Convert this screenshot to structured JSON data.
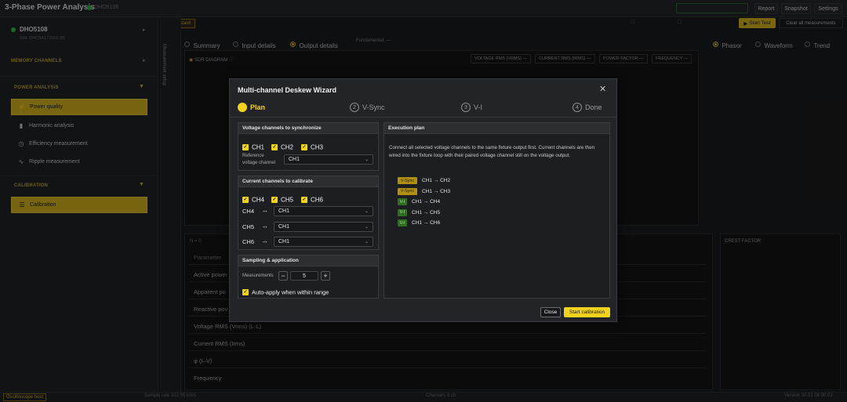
{
  "app": {
    "title": "3-Phase Power Analysis",
    "device_tag": "DHO5108",
    "live_status": "",
    "topbar_buttons": [
      "Report",
      "Snapshot",
      "Settings"
    ],
    "start_test_label": "Start Test",
    "clear_label": "Clear all measurements",
    "wizard_label": "Wizard",
    "wide_toggle_1": "",
    "wide_toggle_2": ""
  },
  "sidebar": {
    "device_name": "DHO5108",
    "device_serial": "S/N: DHO5A172000 (B)",
    "memory_channels": "MEMORY CHANNELS",
    "power_analysis": "POWER ANALYSIS",
    "items": [
      {
        "label": "Power quality",
        "icon": "power-quality-icon",
        "glyph": "⚡"
      },
      {
        "label": "Harmonic analysis",
        "icon": "harmonic-icon",
        "glyph": "▮"
      },
      {
        "label": "Efficiency measurement",
        "icon": "efficiency-icon",
        "glyph": "◷"
      },
      {
        "label": "Ripple measurement",
        "icon": "ripple-icon",
        "glyph": "∿"
      }
    ],
    "calibration": "CALIBRATION",
    "calibration_item": {
      "label": "Calibration",
      "icon": "sliders-icon",
      "glyph": "☰"
    }
  },
  "vertical_tab": "Measurement setup",
  "main": {
    "tabs": [
      "Summary",
      "Input details",
      "Output details"
    ],
    "fundamental": "Fundamental: —",
    "views": [
      "Phasor",
      "Waveform",
      "Trend"
    ],
    "sdr_diagram": "SDR DIAGRAM",
    "chips": [
      "VOLTAGE RMS (VRMS) —",
      "CURRENT RMS (IRMS) —",
      "POWER FACTOR —",
      "FREQUENCY —"
    ],
    "n_label": "N = 0",
    "crest_factor": "CREST FACTOR",
    "table_header": "Parameter",
    "rows": [
      "Active power",
      "Apparent po",
      "Reactive pov",
      "Voltage RMS (Vrms) (L-L)",
      "Current RMS (Irms)",
      "φ (I–V)",
      "Frequency"
    ]
  },
  "statusbar": {
    "osc": "Oscilloscope host",
    "sample_rate": "Sample rate 312.50 kS/s",
    "channels": "Channels 8 ch",
    "version": "Version 00.01.06.00.02"
  },
  "wizard": {
    "title": "Multi-channel Deskew Wizard",
    "steps": [
      {
        "num": "1",
        "label": "Plan"
      },
      {
        "num": "2",
        "label": "V-Sync"
      },
      {
        "num": "3",
        "label": "V-I"
      },
      {
        "num": "4",
        "label": "Done"
      }
    ],
    "voltage_section": "Voltage channels to synchronize",
    "voltage_channels": [
      "CH1",
      "CH2",
      "CH3"
    ],
    "reference_label_1": "Reference",
    "reference_label_2": "voltage channel",
    "reference_value": "CH1",
    "current_section": "Current channels to calibrate",
    "current_channels": [
      "CH4",
      "CH5",
      "CH6"
    ],
    "pairings": [
      {
        "ch": "CH4",
        "value": "CH1"
      },
      {
        "ch": "CH5",
        "value": "CH1"
      },
      {
        "ch": "CH6",
        "value": "CH1"
      }
    ],
    "sampling_section": "Sampling & application",
    "measurements_label": "Measurements",
    "measurements_value": "5",
    "auto_apply_label": "Auto-apply when within range",
    "plan_section": "Execution plan",
    "plan_desc": "Connect all selected voltage channels to the same fixture output first. Current channels are then wired into the fixture loop with their paired voltage channel still on the voltage output.",
    "plan_steps": [
      {
        "badge": "V-Sync",
        "kind": "vs",
        "text": "CH1 → CH2"
      },
      {
        "badge": "V-Sync",
        "kind": "vs",
        "text": "CH1 → CH3"
      },
      {
        "badge": "V-I",
        "kind": "vi",
        "text": "CH1 → CH4"
      },
      {
        "badge": "V-I",
        "kind": "vi",
        "text": "CH1 → CH5"
      },
      {
        "badge": "V-I",
        "kind": "vi",
        "text": "CH1 → CH6"
      }
    ],
    "close_label": "Close",
    "start_label": "Start calibration"
  }
}
